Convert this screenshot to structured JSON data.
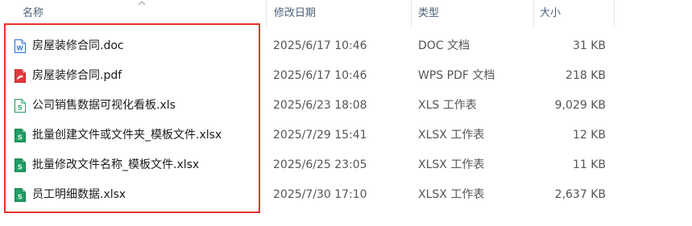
{
  "columns": {
    "name": "名称",
    "date": "修改日期",
    "type": "类型",
    "size": "大小"
  },
  "files": [
    {
      "name": "房屋装修合同.doc",
      "date": "2025/6/17 10:46",
      "type": "DOC 文档",
      "size": "31 KB",
      "icon": "word-doc-icon"
    },
    {
      "name": "房屋装修合同.pdf",
      "date": "2025/6/17 10:46",
      "type": "WPS PDF 文档",
      "size": "218 KB",
      "icon": "pdf-icon"
    },
    {
      "name": "公司销售数据可视化看板.xls",
      "date": "2025/6/23 18:08",
      "type": "XLS 工作表",
      "size": "9,029 KB",
      "icon": "xls-spreadsheet-icon"
    },
    {
      "name": "批量创建文件或文件夹_模板文件.xlsx",
      "date": "2025/7/29 15:41",
      "type": "XLSX 工作表",
      "size": "12 KB",
      "icon": "xlsx-spreadsheet-icon"
    },
    {
      "name": "批量修改文件名称_模板文件.xlsx",
      "date": "2025/6/25 23:05",
      "type": "XLSX 工作表",
      "size": "11 KB",
      "icon": "xlsx-spreadsheet-icon"
    },
    {
      "name": "员工明细数据.xlsx",
      "date": "2025/7/30 17:10",
      "type": "XLSX 工作表",
      "size": "2,637 KB",
      "icon": "xlsx-spreadsheet-icon"
    }
  ],
  "colors": {
    "highlight": "#e8322b",
    "header_text": "#4c607a",
    "word": "#2b6fd6",
    "pdf": "#e0383e",
    "sheet": "#1e9e62"
  }
}
